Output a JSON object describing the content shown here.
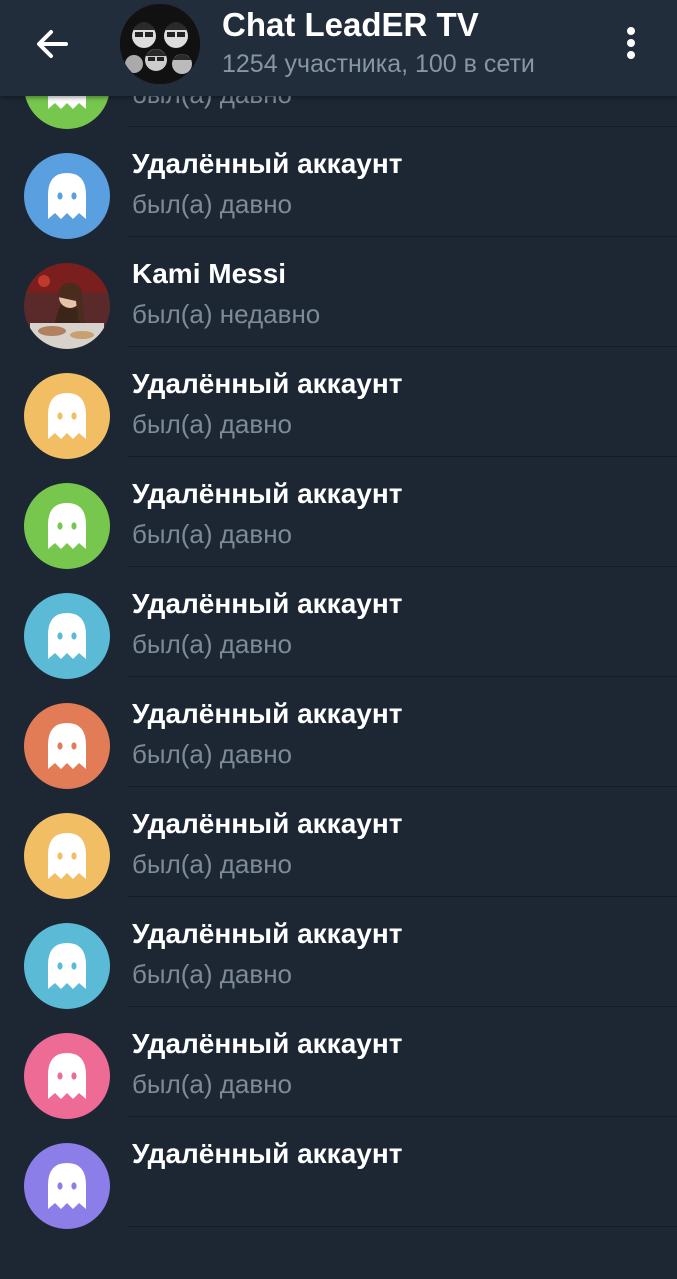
{
  "header": {
    "title": "Chat LeadER TV",
    "subtitle": "1254 участника, 100 в сети",
    "back_icon": "arrow-left-icon",
    "menu_icon": "more-vertical-icon"
  },
  "members": [
    {
      "name": "",
      "status": "был(а) давно",
      "avatar": "ghost",
      "color": "#f2be64"
    },
    {
      "name": "Удалённый аккаунт",
      "status": "был(а) давно",
      "avatar": "ghost",
      "color": "#77c74e"
    },
    {
      "name": "Удалённый аккаунт",
      "status": "был(а) давно",
      "avatar": "ghost",
      "color": "#5a9fe0"
    },
    {
      "name": "Kami Messi",
      "status": "был(а) недавно",
      "avatar": "photo",
      "color": "#4a2a2a"
    },
    {
      "name": "Удалённый аккаунт",
      "status": "был(а) давно",
      "avatar": "ghost",
      "color": "#f2be64"
    },
    {
      "name": "Удалённый аккаунт",
      "status": "был(а) давно",
      "avatar": "ghost",
      "color": "#77c74e"
    },
    {
      "name": "Удалённый аккаунт",
      "status": "был(а) давно",
      "avatar": "ghost",
      "color": "#5bbbd6"
    },
    {
      "name": "Удалённый аккаунт",
      "status": "был(а) давно",
      "avatar": "ghost",
      "color": "#e27c56"
    },
    {
      "name": "Удалённый аккаунт",
      "status": "был(а) давно",
      "avatar": "ghost",
      "color": "#f2be64"
    },
    {
      "name": "Удалённый аккаунт",
      "status": "был(а) давно",
      "avatar": "ghost",
      "color": "#5bbbd6"
    },
    {
      "name": "Удалённый аккаунт",
      "status": "был(а) давно",
      "avatar": "ghost",
      "color": "#ed6b94"
    },
    {
      "name": "Удалённый аккаунт",
      "status": "",
      "avatar": "ghost",
      "color": "#8c7ee8"
    }
  ]
}
